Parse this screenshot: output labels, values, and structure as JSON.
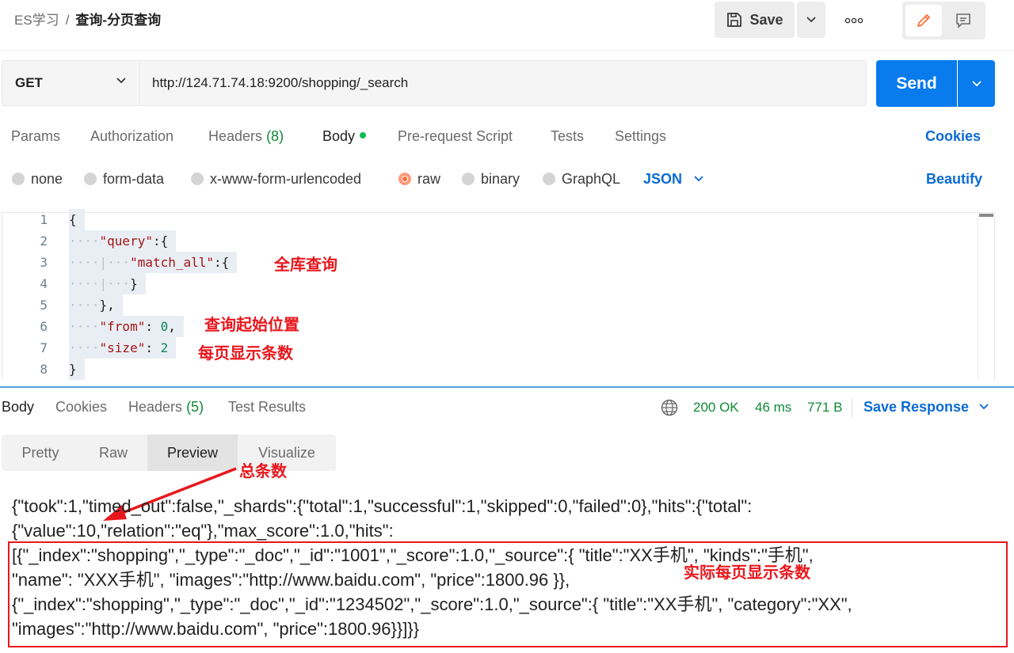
{
  "breadcrumb": {
    "parent": "ES学习",
    "separator": "/",
    "current": "查询-分页查询"
  },
  "toolbar": {
    "save_label": "Save"
  },
  "request": {
    "method": "GET",
    "url": "http://124.71.74.18:9200/shopping/_search",
    "send_label": "Send"
  },
  "tabs": [
    {
      "label": "Params"
    },
    {
      "label": "Authorization"
    },
    {
      "label": "Headers",
      "count": "(8)"
    },
    {
      "label": "Body"
    },
    {
      "label": "Pre-request Script"
    },
    {
      "label": "Tests"
    },
    {
      "label": "Settings"
    }
  ],
  "cookies_label": "Cookies",
  "body_modes": [
    {
      "label": "none"
    },
    {
      "label": "form-data"
    },
    {
      "label": "x-www-form-urlencoded"
    },
    {
      "label": "raw"
    },
    {
      "label": "binary"
    },
    {
      "label": "GraphQL"
    }
  ],
  "format_label": "JSON",
  "beautify_label": "Beautify",
  "editor": {
    "line_numbers": [
      "1",
      "2",
      "3",
      "4",
      "5",
      "6",
      "7",
      "8"
    ],
    "lines": [
      {
        "indent": "",
        "key": "",
        "rest": "{"
      },
      {
        "indent": "····",
        "key": "\"query\"",
        "rest": ":{"
      },
      {
        "indent": "····|···",
        "key": "\"match_all\"",
        "rest": ":{"
      },
      {
        "indent": "····|···",
        "key": "",
        "rest": "}"
      },
      {
        "indent": "····",
        "key": "",
        "rest": "},"
      },
      {
        "indent": "····",
        "key": "\"from\"",
        "rest": ": ",
        "num": "0",
        "tail": ","
      },
      {
        "indent": "····",
        "key": "\"size\"",
        "rest": ": ",
        "num": "2",
        "tail": ""
      },
      {
        "indent": "",
        "key": "",
        "rest": "}"
      }
    ]
  },
  "annotations": {
    "match_all": "全库查询",
    "from": "查询起始位置",
    "size": "每页显示条数",
    "total": "总条数",
    "actual": "实际每页显示条数"
  },
  "response": {
    "tabs": [
      {
        "label": "Body"
      },
      {
        "label": "Cookies"
      },
      {
        "label": "Headers",
        "count": "(5)"
      },
      {
        "label": "Test Results"
      }
    ],
    "status": "200 OK",
    "time": "46 ms",
    "size": "771 B",
    "save_label": "Save Response",
    "view_modes": [
      "Pretty",
      "Raw",
      "Preview",
      "Visualize"
    ],
    "body_lines": [
      "{\"took\":1,\"timed_out\":false,\"_shards\":{\"total\":1,\"successful\":1,\"skipped\":0,\"failed\":0},\"hits\":{\"total\":",
      "{\"value\":10,\"relation\":\"eq\"},\"max_score\":1.0,\"hits\":",
      "[{\"_index\":\"shopping\",\"_type\":\"_doc\",\"_id\":\"1001\",\"_score\":1.0,\"_source\":{ \"title\":\"XX手机\", \"kinds\":\"手机\",",
      "\"name\": \"XXX手机\", \"images\":\"http://www.baidu.com\", \"price\":1800.96 }},",
      "{\"_index\":\"shopping\",\"_type\":\"_doc\",\"_id\":\"1234502\",\"_score\":1.0,\"_source\":{ \"title\":\"XX手机\", \"category\":\"XX\",",
      "\"images\":\"http://www.baidu.com\", \"price\":1800.96}}]}}"
    ]
  },
  "colors": {
    "accent": "#097bed",
    "annotation": "#e8171d",
    "status_ok": "#0f8a38",
    "active_tab": "#ff6c37"
  }
}
